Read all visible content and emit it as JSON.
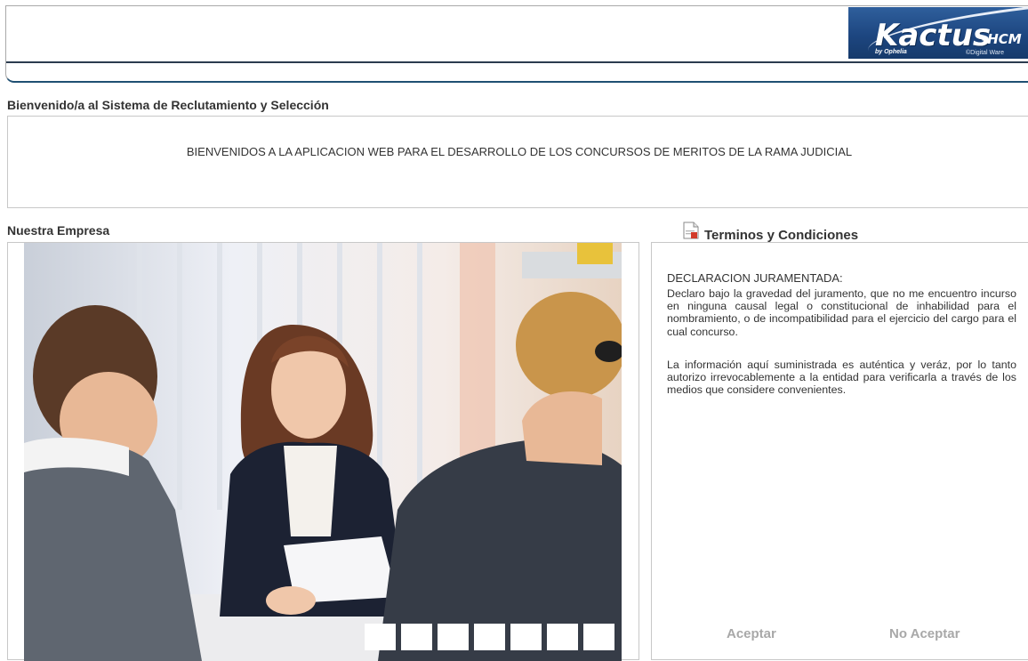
{
  "header": {
    "logo": {
      "word": "Kactus",
      "suffix": "-HCM",
      "by_line": "by Ophelia",
      "brand": "©Digital Ware"
    }
  },
  "welcome": {
    "title": "Bienvenido/a al Sistema de Reclutamiento y Selección",
    "message": "BIENVENIDOS A LA APLICACION WEB PARA EL DESARROLLO DE LOS CONCURSOS DE MERITOS DE LA RAMA JUDICIAL"
  },
  "company": {
    "title": "Nuestra Empresa",
    "slide_count": 7
  },
  "terms": {
    "title": "Terminos y Condiciones",
    "icon": "document-icon",
    "heading": "DECLARACION JURAMENTADA:",
    "paragraph_1": "Declaro bajo la gravedad del juramento, que no me encuentro incurso en ninguna causal legal o constitucional de inhabilidad para el nombramiento, o de incompatibilidad para el ejercicio del cargo para el cual concurso.",
    "paragraph_2": "La información aquí suministrada es auténtica y veráz, por lo tanto autorizo irrevocablemente a la entidad para verificarla a través de los medios que considere convenientes.",
    "accept_label": "Aceptar",
    "decline_label": "No Aceptar"
  },
  "colors": {
    "header_border": "#1f4f72",
    "logo_blue": "#1d4680",
    "text": "#333333",
    "disabled_button": "#a8a8a8"
  }
}
